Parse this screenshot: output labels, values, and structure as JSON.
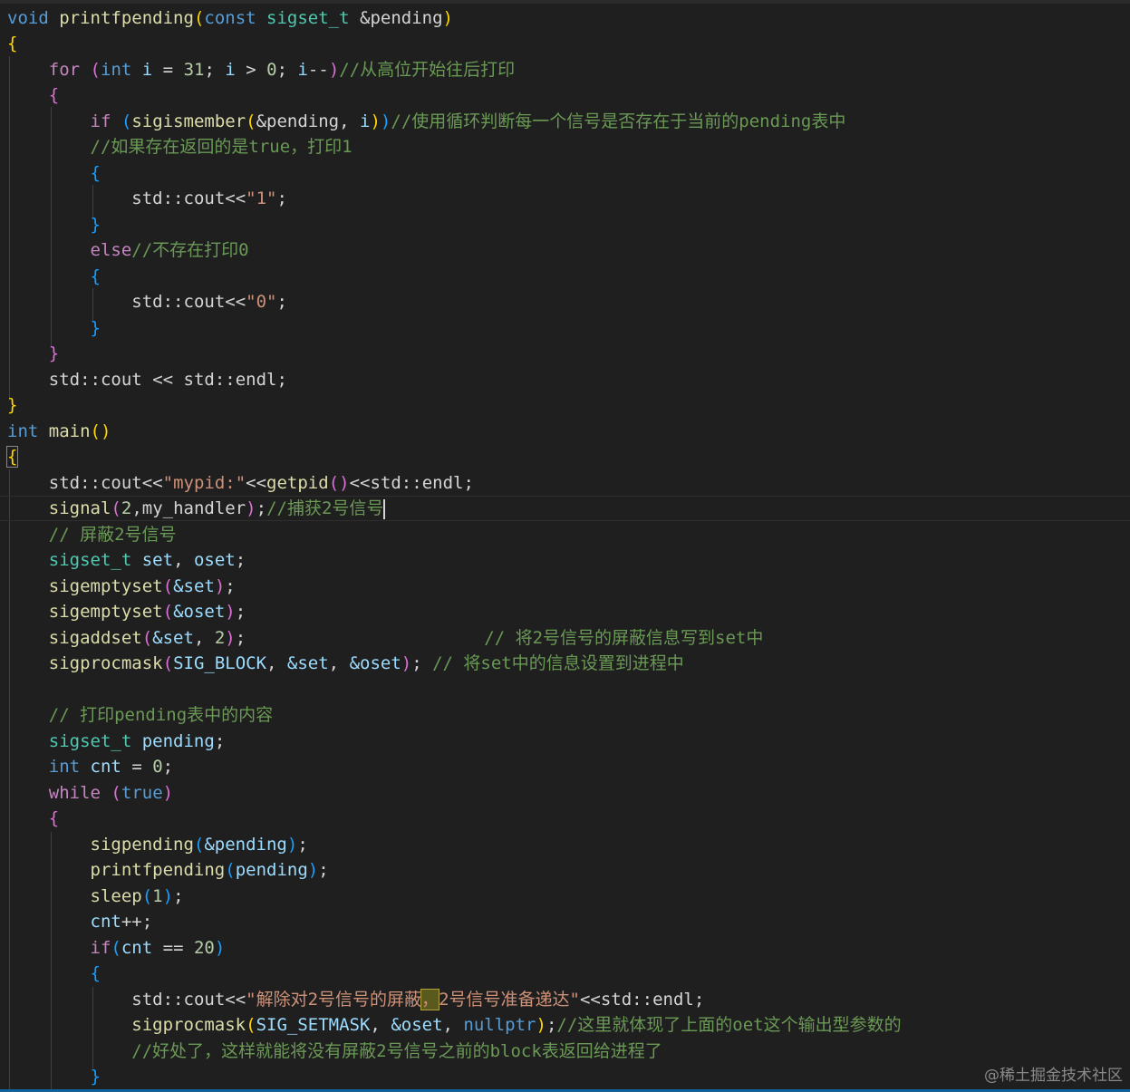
{
  "code": {
    "l1": {
      "kw_void": "void",
      "fn": "printfpending",
      "op": "(",
      "kw_const": "const",
      "ty": "sigset_t",
      "param": "&pending",
      "cp": ")"
    },
    "l2": {
      "brace": "{"
    },
    "l3": {
      "kw_for": "for",
      "op": "(",
      "kw_int": "int",
      "v1": "i",
      "eq": " = ",
      "n31": "31",
      "sc": "; ",
      "v2": "i",
      "gt": " > ",
      "n0": "0",
      "sc2": "; ",
      "v3": "i",
      "dec": "--",
      "cp": ")",
      "comment": "//从高位开始往后打印"
    },
    "l4": {
      "brace": "{"
    },
    "l5": {
      "kw_if": "if",
      "op": "(",
      "fn": "sigismember",
      "op2": "(",
      "arg1": "&pending",
      "comma": ", ",
      "arg2": "i",
      "cp2": ")",
      "cp": ")",
      "comment": "//使用循环判断每一个信号是否存在于当前的pending表中"
    },
    "l6": {
      "comment": "//如果存在返回的是true，打印1"
    },
    "l7": {
      "brace": "{"
    },
    "l8": {
      "ns": "std",
      "sep": "::",
      "obj": "cout",
      "op": "<<",
      "str": "\"1\"",
      "sc": ";"
    },
    "l9": {
      "brace": "}"
    },
    "l10": {
      "kw_else": "else",
      "comment": "//不存在打印0"
    },
    "l11": {
      "brace": "{"
    },
    "l12": {
      "ns": "std",
      "sep": "::",
      "obj": "cout",
      "op": "<<",
      "str": "\"0\"",
      "sc": ";"
    },
    "l13": {
      "brace": "}"
    },
    "l14": {
      "brace": "}"
    },
    "l15": {
      "ns": "std",
      "sep": "::",
      "obj": "cout",
      "op": " << ",
      "ns2": "std",
      "sep2": "::",
      "endl": "endl",
      "sc": ";"
    },
    "l16": {
      "brace": "}"
    },
    "l17": {
      "kw_int": "int",
      "fn": "main",
      "op": "()"
    },
    "l18": {
      "brace": "{"
    },
    "l19": {
      "ns": "std",
      "sep": "::",
      "obj": "cout",
      "op": "<<",
      "str": "\"mypid:\"",
      "op2": "<<",
      "fn": "getpid",
      "call": "()",
      "op3": "<<",
      "ns2": "std",
      "sep2": "::",
      "endl": "endl",
      "sc": ";"
    },
    "l20": {
      "fn": "signal",
      "op": "(",
      "n2": "2",
      "comma": ",",
      "handler": "my_handler",
      "cp": ")",
      "sc": ";",
      "comment": "//捕获2号信号"
    },
    "l21": {
      "comment": "// 屏蔽2号信号"
    },
    "l22": {
      "ty": "sigset_t",
      "v1": "set",
      "comma": ", ",
      "v2": "oset",
      "sc": ";"
    },
    "l23": {
      "fn": "sigemptyset",
      "op": "(",
      "arg": "&set",
      "cp": ")",
      "sc": ";"
    },
    "l24": {
      "fn": "sigemptyset",
      "op": "(",
      "arg": "&oset",
      "cp": ")",
      "sc": ";"
    },
    "l25": {
      "fn": "sigaddset",
      "op": "(",
      "arg": "&set",
      "comma": ", ",
      "n2": "2",
      "cp": ")",
      "sc": ";",
      "pad": "                       ",
      "comment": "// 将2号信号的屏蔽信息写到set中"
    },
    "l26": {
      "fn": "sigprocmask",
      "op": "(",
      "macro": "SIG_BLOCK",
      "comma": ", ",
      "arg2": "&set",
      "comma2": ", ",
      "arg3": "&oset",
      "cp": ")",
      "sc": "; ",
      "comment": "// 将set中的信息设置到进程中"
    },
    "l28": {
      "comment": "// 打印pending表中的内容"
    },
    "l29": {
      "ty": "sigset_t",
      "v": "pending",
      "sc": ";"
    },
    "l30": {
      "kw_int": "int",
      "v": "cnt",
      "eq": " = ",
      "n0": "0",
      "sc": ";"
    },
    "l31": {
      "kw_while": "while",
      "op": "(",
      "kw_true": "true",
      "cp": ")"
    },
    "l32": {
      "brace": "{"
    },
    "l33": {
      "fn": "sigpending",
      "op": "(",
      "arg": "&pending",
      "cp": ")",
      "sc": ";"
    },
    "l34": {
      "fn": "printfpending",
      "op": "(",
      "arg": "pending",
      "cp": ")",
      "sc": ";"
    },
    "l35": {
      "fn": "sleep",
      "op": "(",
      "n1": "1",
      "cp": ")",
      "sc": ";"
    },
    "l36": {
      "v": "cnt",
      "inc": "++",
      "sc": ";"
    },
    "l37": {
      "kw_if": "if",
      "op": "(",
      "v": "cnt",
      "eq": " == ",
      "n20": "20",
      "cp": ")"
    },
    "l38": {
      "brace": "{"
    },
    "l39": {
      "ns": "std",
      "sep": "::",
      "obj": "cout",
      "op": "<<",
      "str_a": "\"解除对2号信号的屏蔽",
      "str_b": "，",
      "str_c": "2号信号准备递达\"",
      "op2": "<<",
      "ns2": "std",
      "sep2": "::",
      "endl": "endl",
      "sc": ";"
    },
    "l40": {
      "fn": "sigprocmask",
      "op": "(",
      "macro": "SIG_SETMASK",
      "comma": ", ",
      "arg2": "&oset",
      "comma2": ", ",
      "kw_null": "nullptr",
      "cp": ")",
      "sc": ";",
      "comment": "//这里就体现了上面的oet这个输出型参数的"
    },
    "l41": {
      "comment": "//好处了，这样就能将没有屏蔽2号信号之前的block表返回给进程了"
    },
    "l42": {
      "brace": "}"
    }
  },
  "watermark": "@稀土掘金技术社区",
  "colors": {
    "background": "#1f1f1f",
    "keyword": "#569cd6",
    "control": "#c586c0",
    "function": "#dcdcaa",
    "type": "#4ec9b0",
    "variable": "#9cdcfe",
    "number": "#b5cea8",
    "string": "#ce9178",
    "comment": "#6a9955",
    "bracket_level1": "#ffd700",
    "bracket_level2": "#da70d6",
    "bracket_level3": "#179fff"
  }
}
